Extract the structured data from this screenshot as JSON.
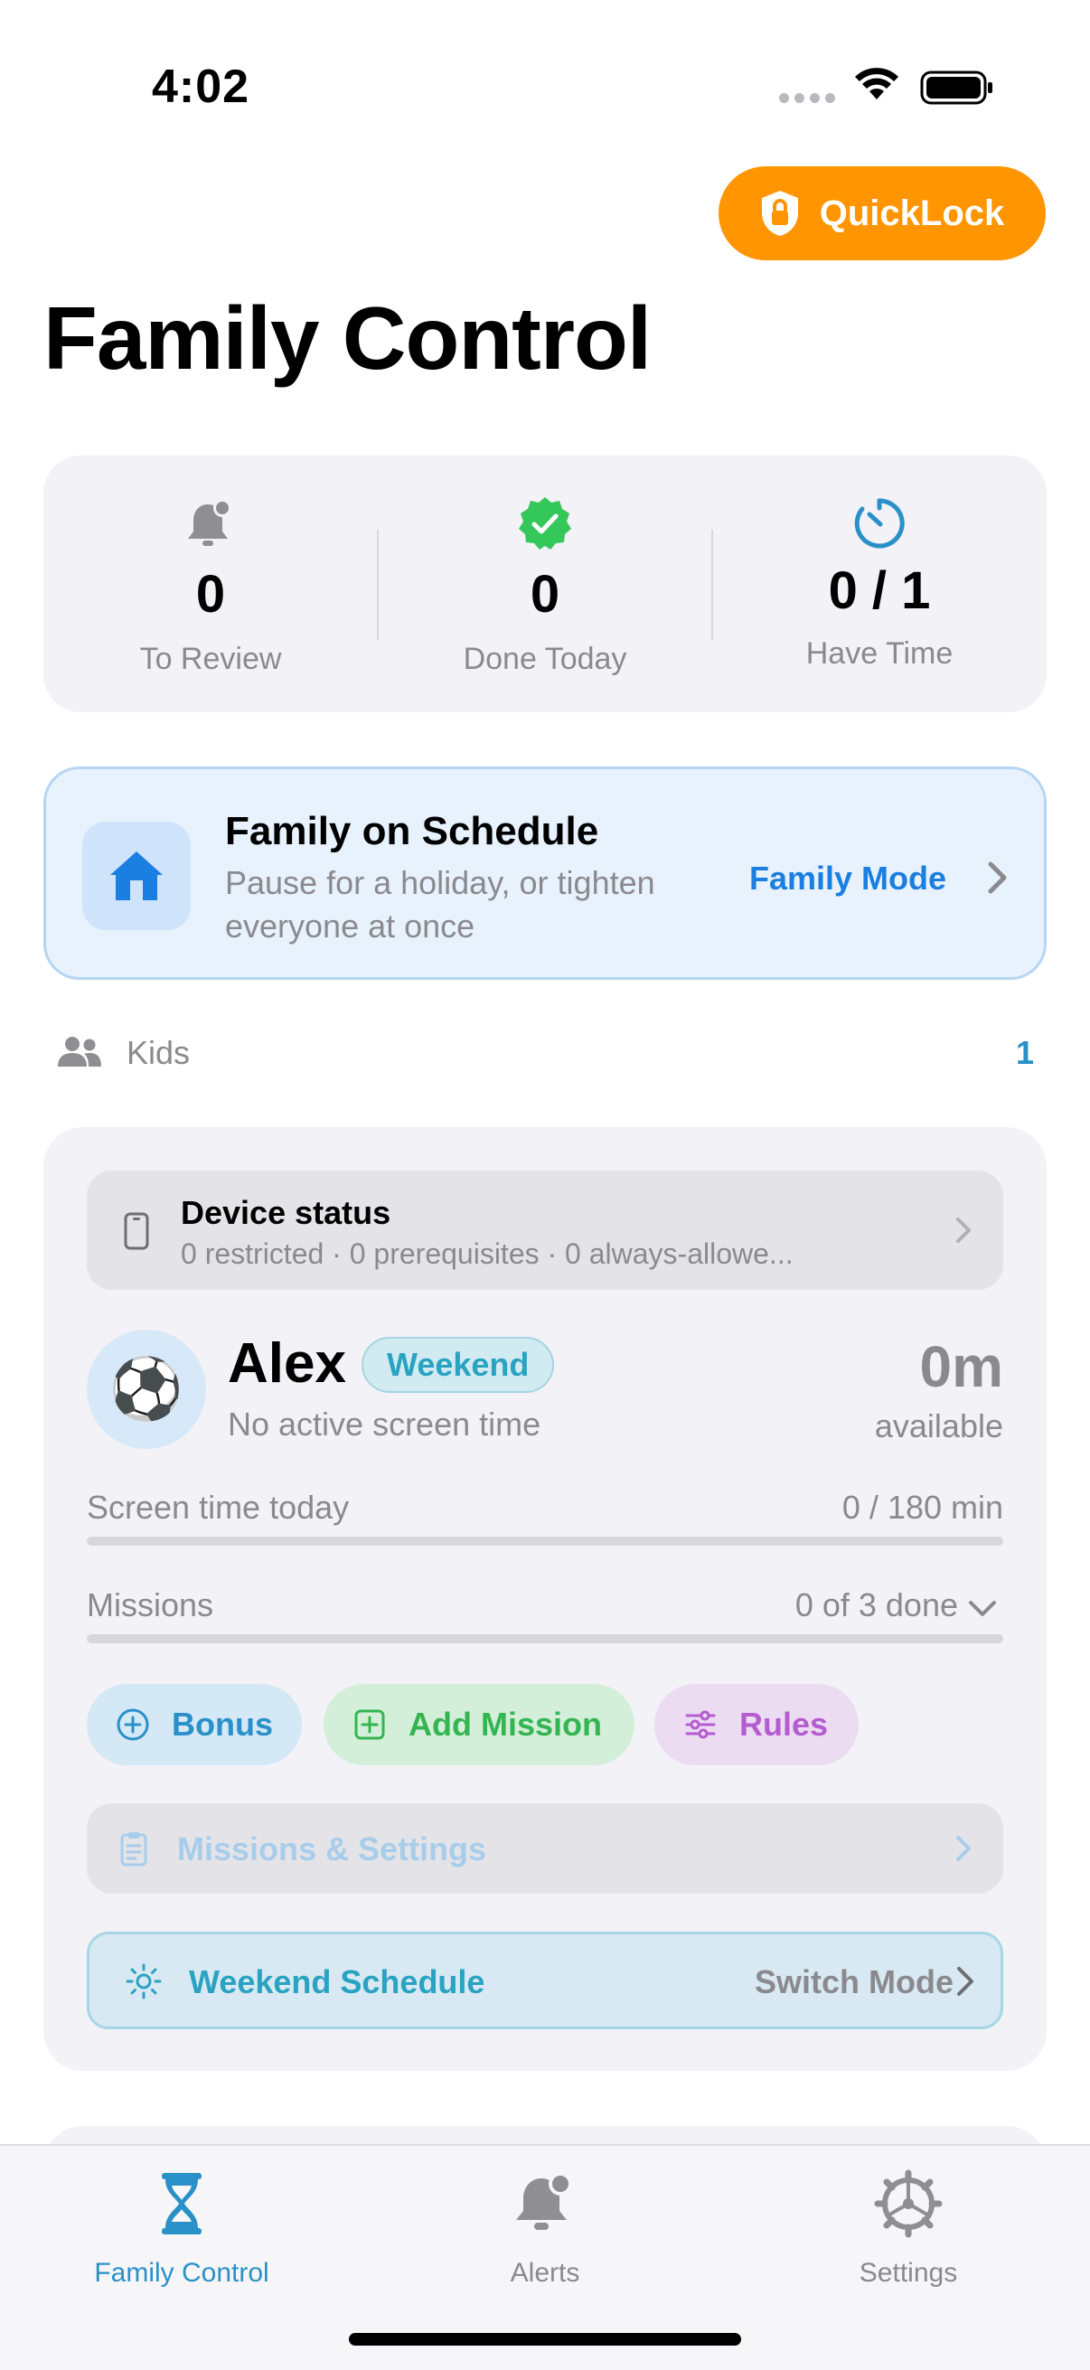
{
  "status_bar": {
    "time": "4:02"
  },
  "quicklock": {
    "label": "QuickLock"
  },
  "page": {
    "title": "Family Control"
  },
  "stats": [
    {
      "value": "0",
      "label": "To Review",
      "icon": "bell-badge-icon"
    },
    {
      "value": "0",
      "label": "Done Today",
      "icon": "checkmark-seal-icon"
    },
    {
      "value": "0 / 1",
      "label": "Have Time",
      "icon": "timer-icon"
    }
  ],
  "schedule_banner": {
    "title": "Family on Schedule",
    "subtitle": "Pause for a holiday, or tighten everyone at once",
    "action": "Family Mode"
  },
  "kids_section": {
    "label": "Kids",
    "count": "1"
  },
  "kid": {
    "device_status": {
      "title": "Device status",
      "summary": "0 restricted · 0 prerequisites · 0 always-allowe..."
    },
    "avatar_emoji": "⚽",
    "name": "Alex",
    "mode_badge": "Weekend",
    "status": "No active screen time",
    "available_value": "0m",
    "available_label": "available",
    "screen_time": {
      "label": "Screen time today",
      "value": "0 / 180 min",
      "used_fraction": 0
    },
    "missions": {
      "label": "Missions",
      "value": "0 of 3 done",
      "done_fraction": 0
    },
    "actions": {
      "bonus": "Bonus",
      "add_mission": "Add Mission",
      "rules": "Rules"
    },
    "settings_link": "Missions & Settings",
    "schedule": {
      "label": "Weekend Schedule",
      "action": "Switch Mode"
    }
  },
  "tab_bar": {
    "tabs": [
      {
        "label": "Family Control",
        "icon": "hourglass-icon",
        "active": true
      },
      {
        "label": "Alerts",
        "icon": "bell-badge-icon",
        "active": false
      },
      {
        "label": "Settings",
        "icon": "gear-icon",
        "active": false
      }
    ]
  },
  "colors": {
    "accent": "#2a90c8",
    "quicklock": "#ff9500",
    "success": "#34c759",
    "rules": "#b55cd0"
  }
}
